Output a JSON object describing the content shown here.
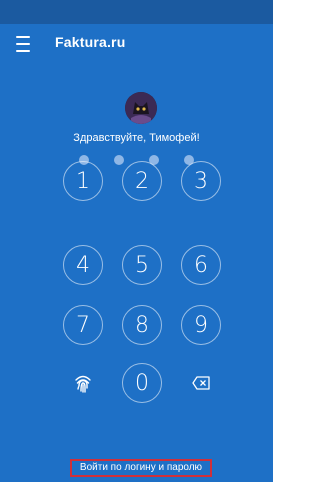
{
  "app": {
    "title": "Faktura.ru"
  },
  "greeting": "Здравствуйте, Тимофей!",
  "pin": {
    "length": 4,
    "entered": 0
  },
  "keypad": {
    "keys": [
      "1",
      "2",
      "3",
      "4",
      "5",
      "6",
      "7",
      "8",
      "9",
      "0"
    ],
    "fingerprint_icon": "fingerprint-icon",
    "backspace_icon": "backspace-icon"
  },
  "login_link": "Войти по логину и паролю",
  "colors": {
    "background": "#1e70c6",
    "statusbar": "#1b5aa0",
    "pin_dot": "#8fb7e6",
    "highlight": "#d0303a"
  }
}
